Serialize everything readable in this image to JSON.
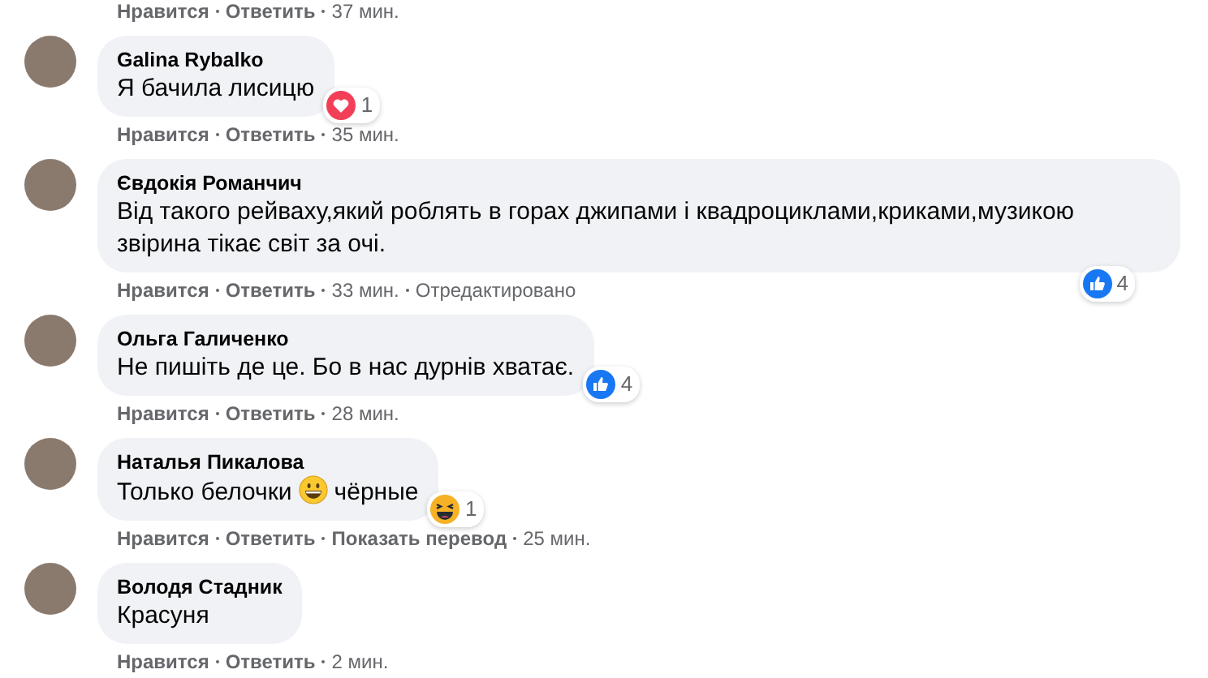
{
  "top_actions": [
    {
      "text": "Нравится",
      "kind": "link"
    },
    {
      "text": "Ответить",
      "kind": "link"
    },
    {
      "text": "37 мин.",
      "kind": "meta"
    }
  ],
  "comments": [
    {
      "author": "Galina Rybalko",
      "parts": [
        {
          "kind": "text",
          "text": "Я бачила лисицю"
        }
      ],
      "reaction": {
        "kind": "heart",
        "count": "1"
      },
      "actions": [
        {
          "text": "Нравится",
          "kind": "link"
        },
        {
          "text": "Ответить",
          "kind": "link"
        },
        {
          "text": "35 мин.",
          "kind": "meta"
        }
      ]
    },
    {
      "author": "Євдокія Романчич",
      "parts": [
        {
          "kind": "text",
          "text": "Від такого рейваху,який роблять в горах джипами і квадроциклами,криками,музикою звірина тікає світ за очі."
        }
      ],
      "reaction": {
        "kind": "like",
        "count": "4"
      },
      "actions": [
        {
          "text": "Нравится",
          "kind": "link"
        },
        {
          "text": "Ответить",
          "kind": "link"
        },
        {
          "text": "33 мин.",
          "kind": "meta"
        },
        {
          "text": "Отредактировано",
          "kind": "meta"
        }
      ]
    },
    {
      "author": "Ольга Галиченко",
      "parts": [
        {
          "kind": "text",
          "text": "Не пишіть де це. Бо в нас дурнів хватає."
        }
      ],
      "reaction": {
        "kind": "like",
        "count": "4"
      },
      "actions": [
        {
          "text": "Нравится",
          "kind": "link"
        },
        {
          "text": "Ответить",
          "kind": "link"
        },
        {
          "text": "28 мин.",
          "kind": "meta"
        }
      ]
    },
    {
      "author": "Наталья Пикалова",
      "parts": [
        {
          "kind": "text",
          "text": "Только белочки"
        },
        {
          "kind": "emoji"
        },
        {
          "kind": "text",
          "text": "чёрные"
        }
      ],
      "reaction": {
        "kind": "haha",
        "count": "1"
      },
      "actions": [
        {
          "text": "Нравится",
          "kind": "link"
        },
        {
          "text": "Ответить",
          "kind": "link"
        },
        {
          "text": "Показать перевод",
          "kind": "link"
        },
        {
          "text": "25 мин.",
          "kind": "meta"
        }
      ]
    },
    {
      "author": "Володя Стадник",
      "parts": [
        {
          "kind": "text",
          "text": "Красуня"
        }
      ],
      "actions": [
        {
          "text": "Нравится",
          "kind": "link"
        },
        {
          "text": "Ответить",
          "kind": "link"
        },
        {
          "text": "2 мин.",
          "kind": "meta"
        }
      ]
    }
  ]
}
